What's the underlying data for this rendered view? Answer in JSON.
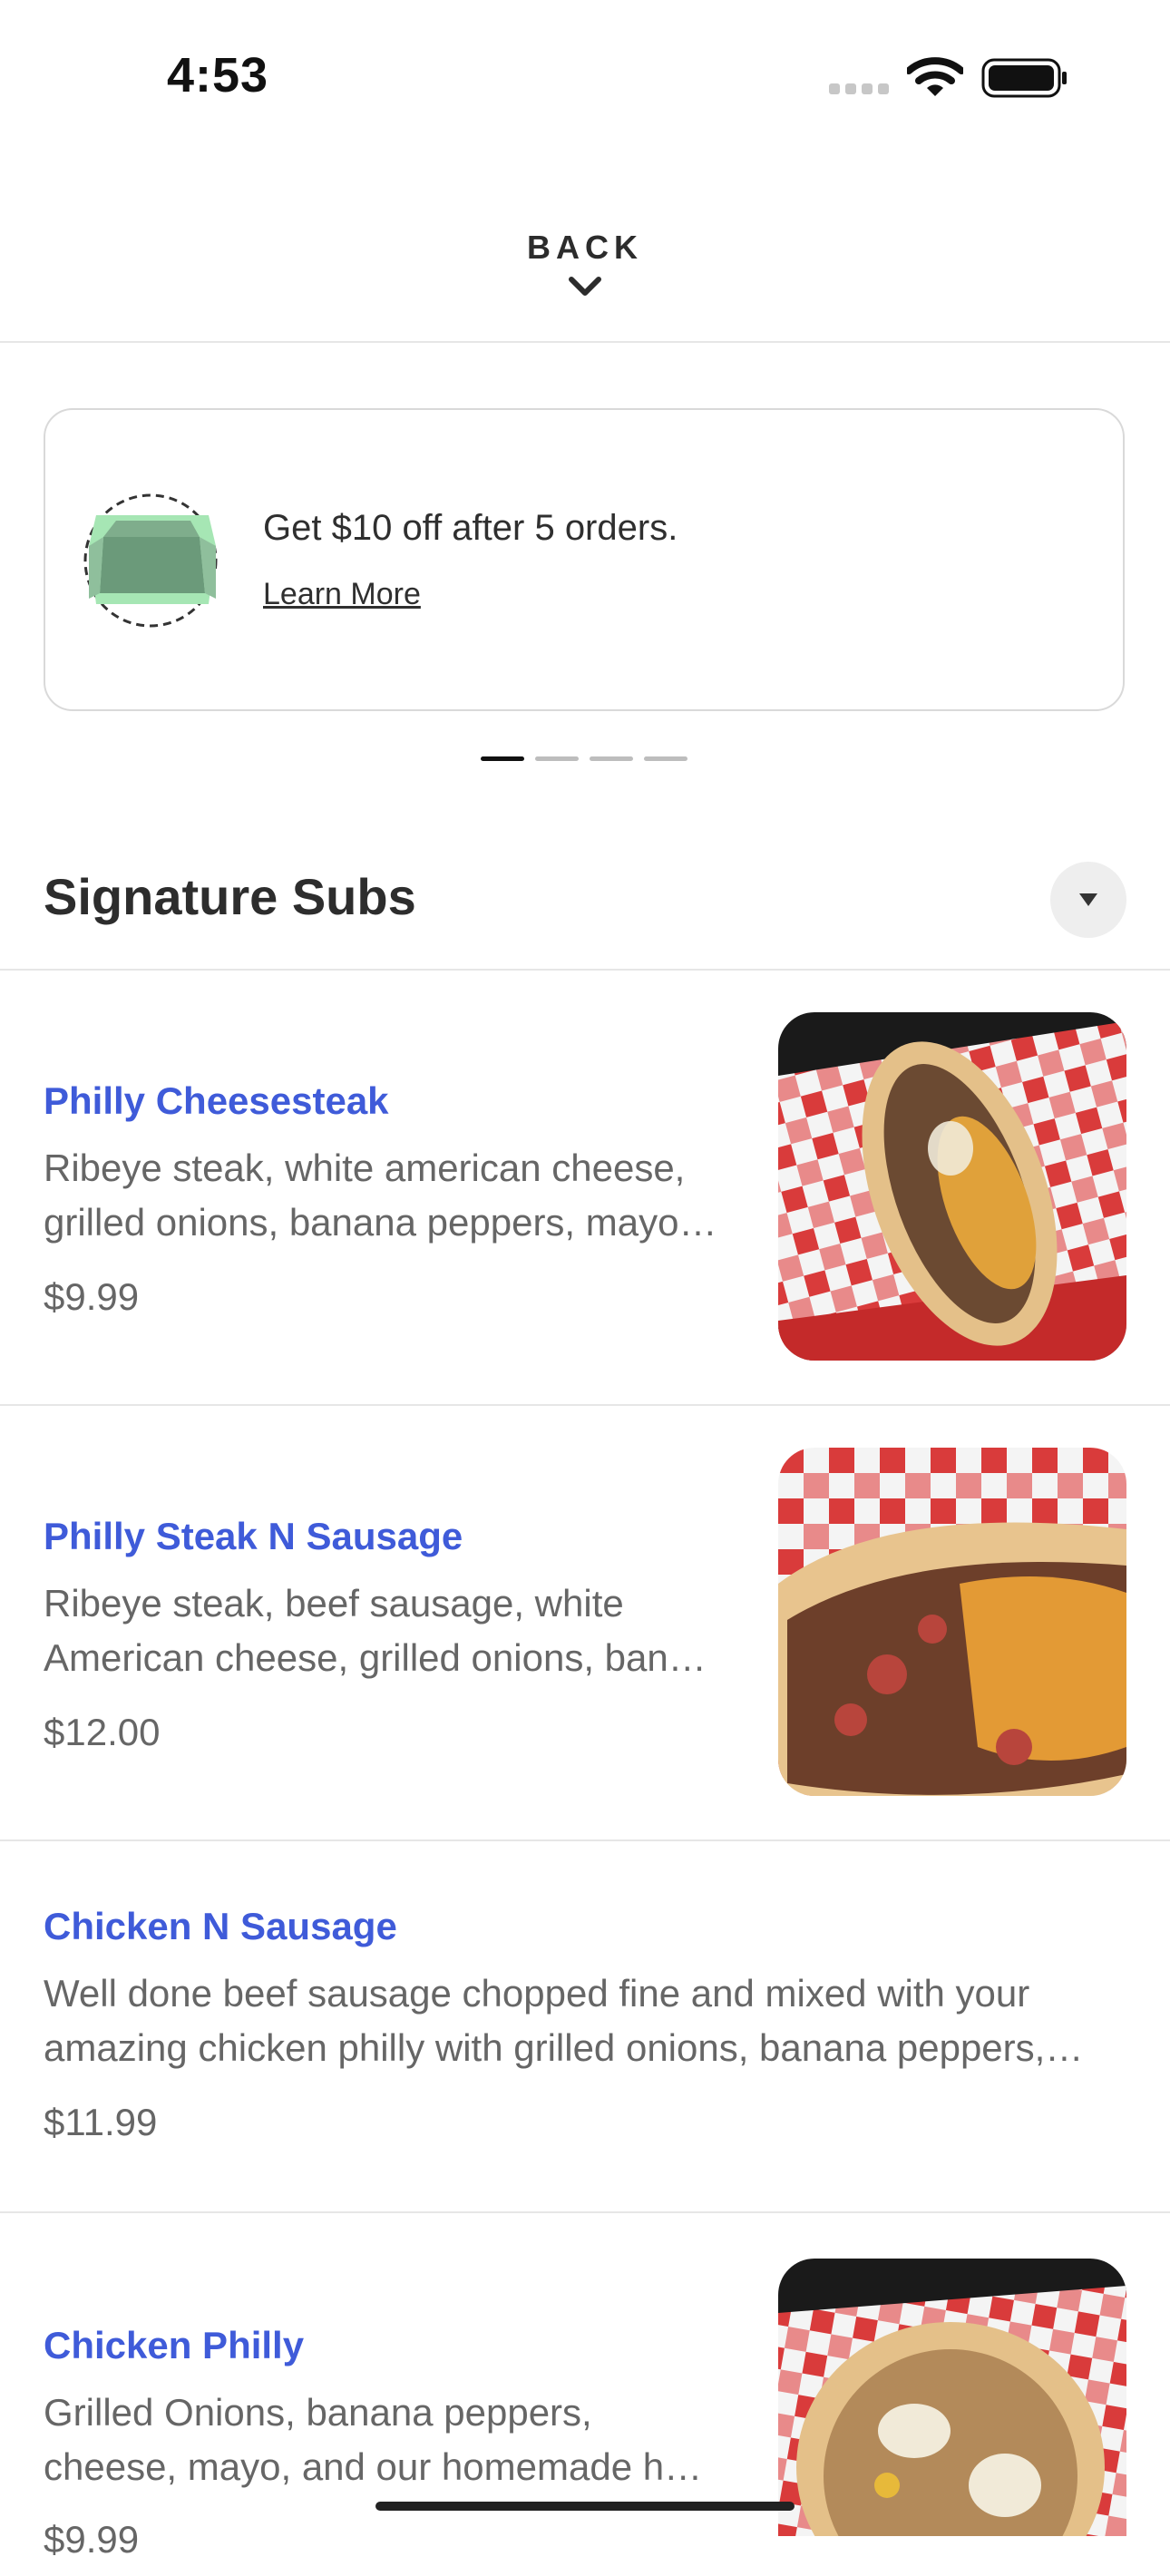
{
  "status_bar": {
    "time": "4:53"
  },
  "header": {
    "back_label": "BACK"
  },
  "promo": {
    "text": "Get $10 off after 5 orders.",
    "link": "Learn More"
  },
  "carousel": {
    "total": 4,
    "active": 1
  },
  "section": {
    "title": "Signature Subs"
  },
  "items": [
    {
      "name": "Philly Cheesesteak",
      "desc_line1": "Ribeye steak, white american cheese,",
      "desc_line2": "grilled onions, banana peppers, mayo…",
      "price": "$9.99"
    },
    {
      "name": "Philly Steak N Sausage",
      "desc_line1": "Ribeye steak, beef sausage, white",
      "desc_line2": "American cheese, grilled onions, ban…",
      "price": "$12.00"
    },
    {
      "name": "Chicken N Sausage",
      "desc_line1": "Well done beef sausage chopped fine and mixed with your",
      "desc_line2": "amazing chicken philly with grilled onions, banana peppers,…",
      "price": "$11.99"
    },
    {
      "name": "Chicken Philly",
      "desc_line1": "Grilled Onions, banana peppers,",
      "desc_line2": "cheese, mayo, and our homemade h…",
      "price": "$9.99"
    }
  ],
  "colors": {
    "item_name": "#3f5bd9",
    "promo_icon": "#a6e6b4",
    "checker": "#d93b3b"
  }
}
